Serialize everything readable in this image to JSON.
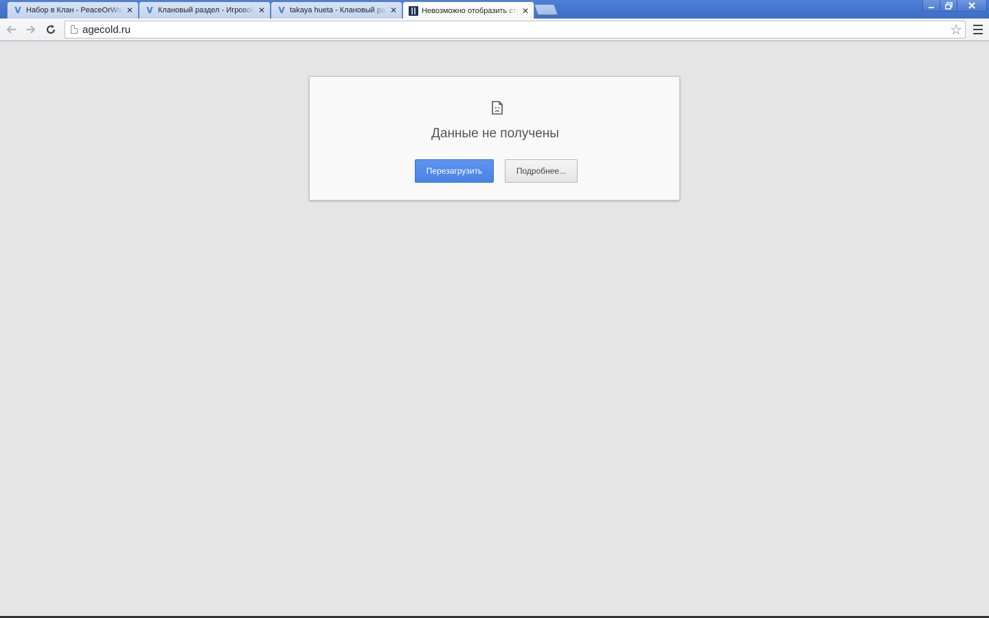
{
  "tabs": [
    {
      "title": "Набор в Клан - PeaceOrWar",
      "favicon": "v-favicon-icon",
      "active": false
    },
    {
      "title": "Клановый раздел - Игровой",
      "favicon": "v-favicon-icon",
      "active": false
    },
    {
      "title": "takaya hueta - Клановый раздел",
      "favicon": "v-favicon-icon",
      "active": false
    },
    {
      "title": "Невозможно отобразить страницу",
      "favicon": "dark-site-icon",
      "active": true
    }
  ],
  "window_controls": {
    "minimize": "minimize-icon",
    "maximize": "restore-icon",
    "close": "close-icon"
  },
  "toolbar": {
    "url": "agecold.ru",
    "back_icon": "back-arrow-icon",
    "forward_icon": "forward-arrow-icon",
    "reload_icon": "reload-icon",
    "bookmark_icon": "star-icon",
    "menu_icon": "hamburger-menu-icon"
  },
  "error": {
    "title": "Данные не получены",
    "reload_label": "Перезагрузить",
    "details_label": "Подробнее..."
  },
  "colors": {
    "titlebar": "#3b6ec9",
    "page_background": "#e5e5e5",
    "primary_button": "#4a83e6"
  }
}
